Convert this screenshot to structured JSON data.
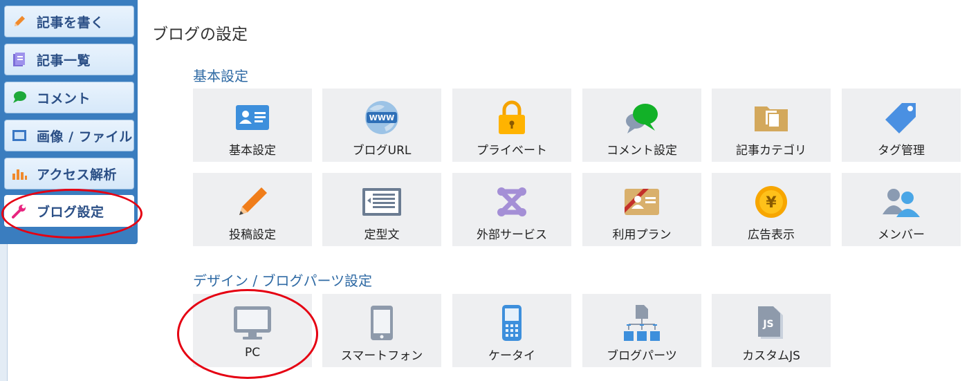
{
  "sidebar": {
    "items": [
      {
        "label": "記事を書く",
        "icon": "pencil-icon"
      },
      {
        "label": "記事一覧",
        "icon": "document-list-icon"
      },
      {
        "label": "コメント",
        "icon": "speech-bubble-icon"
      },
      {
        "label": "画像 / ファイル",
        "icon": "image-icon"
      },
      {
        "label": "アクセス解析",
        "icon": "bar-chart-icon"
      },
      {
        "label": "ブログ設定",
        "icon": "wrench-icon"
      }
    ],
    "active_index": 5
  },
  "page": {
    "title": "ブログの設定"
  },
  "sections": [
    {
      "title": "基本設定",
      "tiles": [
        {
          "label": "基本設定",
          "icon": "id-card-icon"
        },
        {
          "label": "ブログURL",
          "icon": "www-globe-icon"
        },
        {
          "label": "プライベート",
          "icon": "padlock-icon"
        },
        {
          "label": "コメント設定",
          "icon": "comment-bubbles-icon"
        },
        {
          "label": "記事カテゴリ",
          "icon": "folder-icon"
        },
        {
          "label": "タグ管理",
          "icon": "tag-icon"
        },
        {
          "label": "投稿設定",
          "icon": "pencil-icon"
        },
        {
          "label": "定型文",
          "icon": "template-text-icon"
        },
        {
          "label": "外部サービス",
          "icon": "external-service-icon"
        },
        {
          "label": "利用プラン",
          "icon": "plan-card-icon"
        },
        {
          "label": "広告表示",
          "icon": "yen-coin-icon"
        },
        {
          "label": "メンバー",
          "icon": "members-icon"
        }
      ]
    },
    {
      "title": "デザイン / ブログパーツ設定",
      "tiles": [
        {
          "label": "PC",
          "icon": "monitor-icon"
        },
        {
          "label": "スマートフォン",
          "icon": "smartphone-icon"
        },
        {
          "label": "ケータイ",
          "icon": "feature-phone-icon"
        },
        {
          "label": "ブログパーツ",
          "icon": "blog-parts-icon"
        },
        {
          "label": "カスタムJS",
          "icon": "js-file-icon"
        }
      ]
    }
  ],
  "annotation_color": "#e50012"
}
